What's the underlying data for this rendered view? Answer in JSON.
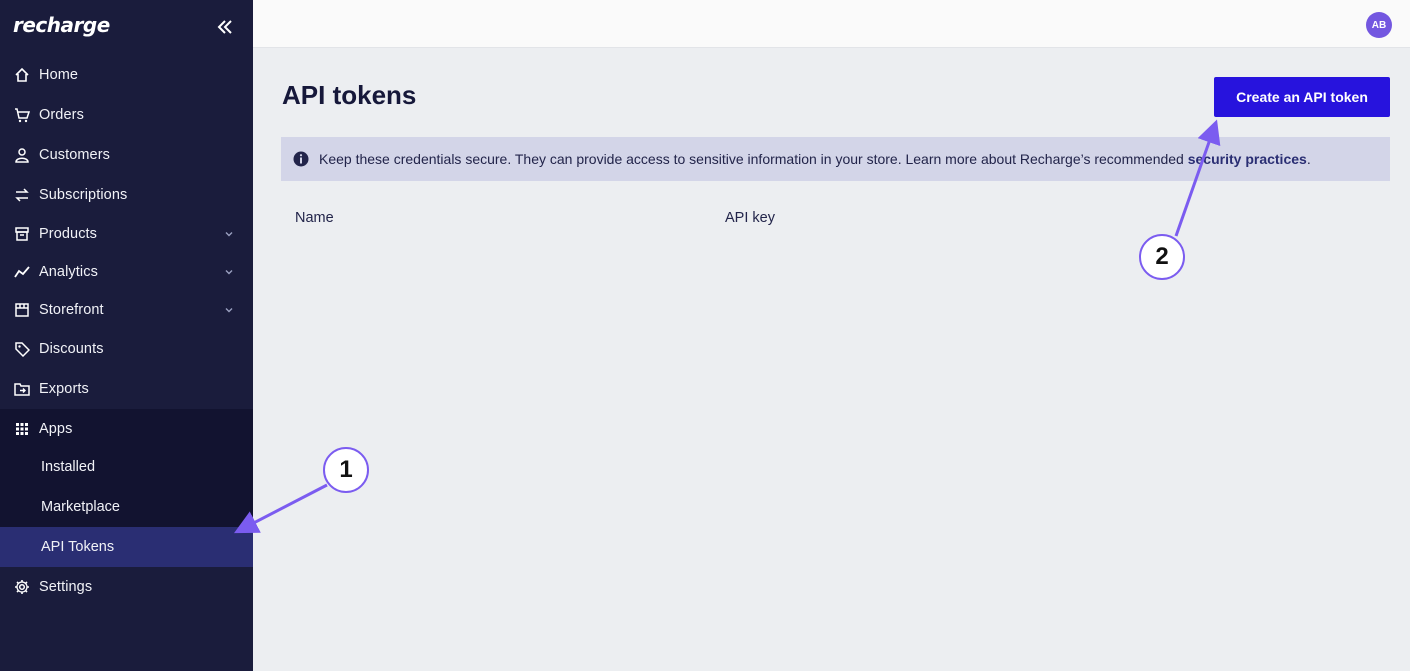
{
  "sidebar": {
    "logo": "recharge",
    "items": [
      {
        "label": "Home"
      },
      {
        "label": "Orders"
      },
      {
        "label": "Customers"
      },
      {
        "label": "Subscriptions"
      },
      {
        "label": "Products"
      },
      {
        "label": "Analytics"
      },
      {
        "label": "Storefront"
      },
      {
        "label": "Discounts"
      },
      {
        "label": "Exports"
      },
      {
        "label": "Apps"
      },
      {
        "label": "Settings"
      }
    ],
    "apps_sub": [
      {
        "label": "Installed"
      },
      {
        "label": "Marketplace"
      },
      {
        "label": "API Tokens"
      }
    ]
  },
  "topbar": {
    "avatar_initials": "AB"
  },
  "main": {
    "title": "API tokens",
    "create_button": "Create an API token",
    "banner_text": "Keep these credentials secure. They can provide access to sensitive information in your store. Learn more about Recharge’s recommended ",
    "banner_link": "security practices",
    "banner_end": ".",
    "columns": [
      "Name",
      "API key"
    ]
  },
  "annotations": {
    "badge1": "1",
    "badge2": "2"
  },
  "colors": {
    "sidebar_bg": "#1a1c3c",
    "active_item": "#2a2e73",
    "primary_button": "#2713dd",
    "annotation": "#7b5cf0"
  },
  "icons": [
    "collapse-icon",
    "home-icon",
    "cart-icon",
    "user-icon",
    "repeat-icon",
    "box-icon",
    "chart-icon",
    "store-icon",
    "tag-icon",
    "export-icon",
    "grid-icon",
    "gear-icon",
    "info-icon",
    "chevron-down-icon"
  ]
}
